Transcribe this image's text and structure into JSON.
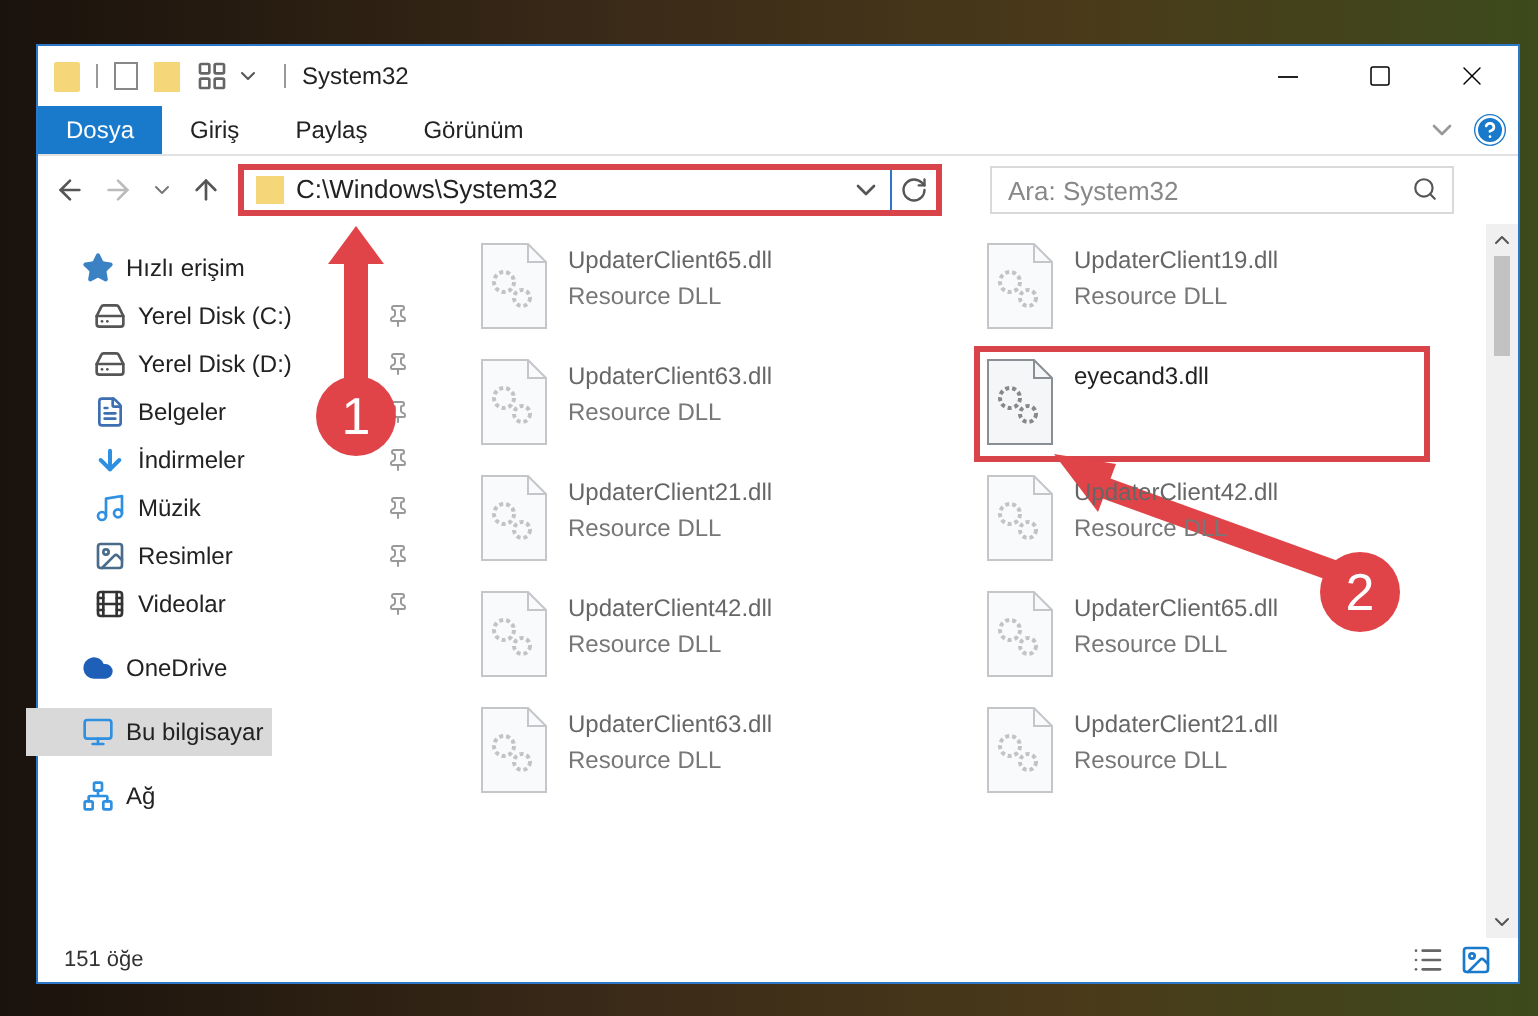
{
  "window": {
    "title": "System32"
  },
  "ribbon_tabs": [
    {
      "label": "Dosya",
      "selected": true
    },
    {
      "label": "Giriş",
      "selected": false
    },
    {
      "label": "Paylaş",
      "selected": false
    },
    {
      "label": "Görünüm",
      "selected": false
    }
  ],
  "address_bar": {
    "path": "C:\\Windows\\System32",
    "highlighted": true
  },
  "search": {
    "placeholder": "Ara: System32"
  },
  "sidebar": {
    "items": [
      {
        "label": "Hızlı erişim",
        "kind": "star",
        "selected": false,
        "children": [
          {
            "label": "Yerel Disk (C:)",
            "kind": "drive",
            "selected": false,
            "pinned": true
          },
          {
            "label": "Yerel Disk (D:)",
            "kind": "drive",
            "selected": false,
            "pinned": true
          },
          {
            "label": "Belgeler",
            "kind": "document",
            "selected": false,
            "pinned": true
          },
          {
            "label": "İndirmeler",
            "kind": "download",
            "selected": false,
            "pinned": true
          },
          {
            "label": "Müzik",
            "kind": "music",
            "selected": false,
            "pinned": true
          },
          {
            "label": "Resimler",
            "kind": "picture",
            "selected": false,
            "pinned": true
          },
          {
            "label": "Videolar",
            "kind": "video",
            "selected": false,
            "pinned": true
          }
        ]
      },
      {
        "label": "OneDrive",
        "kind": "cloud",
        "selected": false
      },
      {
        "label": "Bu bilgisayar",
        "kind": "monitor",
        "selected": true
      },
      {
        "label": "Ağ",
        "kind": "network",
        "selected": false
      }
    ]
  },
  "files": [
    {
      "name": "UpdaterClient65.dll",
      "type": "Resource DLL",
      "blurred": true,
      "highlighted": false
    },
    {
      "name": "UpdaterClient19.dll",
      "type": "Resource DLL",
      "blurred": true,
      "highlighted": false
    },
    {
      "name": "UpdaterClient63.dll",
      "type": "Resource DLL",
      "blurred": true,
      "highlighted": false
    },
    {
      "name": "eyecand3.dll",
      "blurred": false,
      "highlighted": true
    },
    {
      "name": "UpdaterClient21.dll",
      "type": "Resource DLL",
      "blurred": true,
      "highlighted": false
    },
    {
      "name": "UpdaterClient42.dll",
      "type": "Resource DLL",
      "blurred": true,
      "highlighted": false
    },
    {
      "name": "UpdaterClient42.dll",
      "type": "Resource DLL",
      "blurred": true,
      "highlighted": false
    },
    {
      "name": "UpdaterClient65.dll",
      "type": "Resource DLL",
      "blurred": true,
      "highlighted": false
    },
    {
      "name": "UpdaterClient63.dll",
      "type": "Resource DLL",
      "blurred": true,
      "highlighted": false
    },
    {
      "name": "UpdaterClient21.dll",
      "type": "Resource DLL",
      "blurred": true,
      "highlighted": false
    }
  ],
  "status_bar": {
    "item_count": "151 öğe"
  },
  "annotations": [
    {
      "label": "1"
    },
    {
      "label": "2"
    }
  ]
}
